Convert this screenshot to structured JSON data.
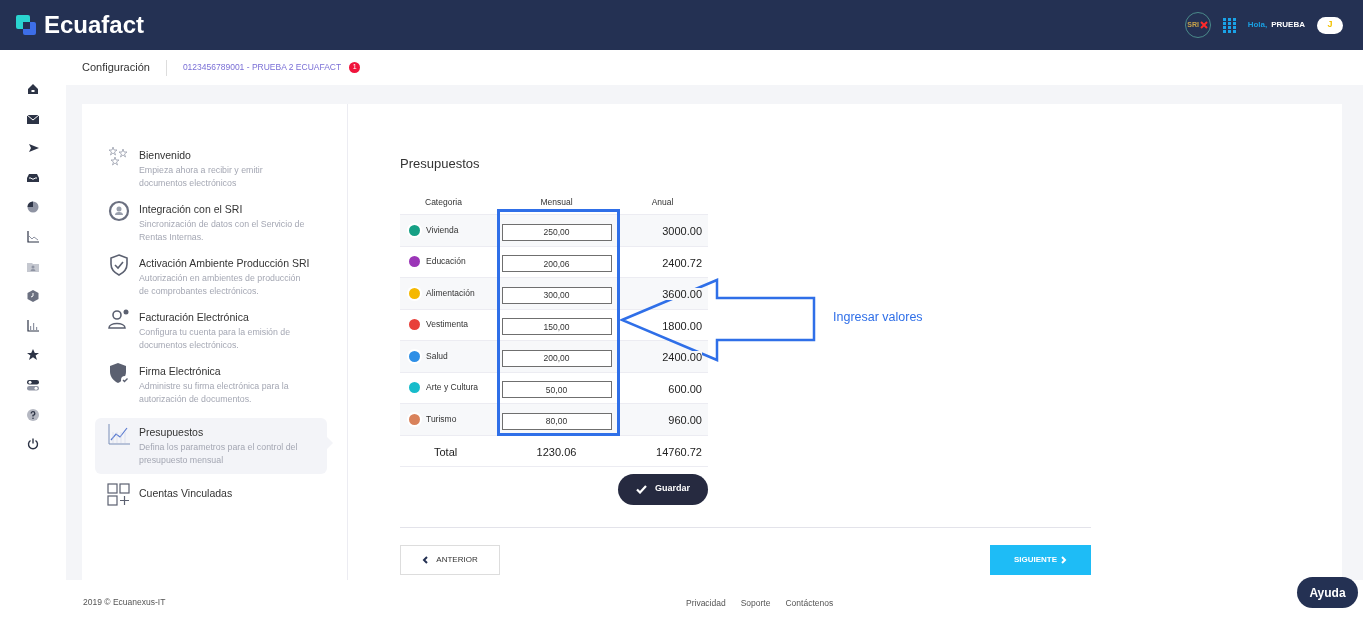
{
  "header": {
    "logo": "Ecuafact",
    "sri_badge": "SRI",
    "greeting": "Hola,",
    "user": "PRUEBA",
    "avatar": "J"
  },
  "breadcrumb": {
    "title": "Configuración",
    "company": "0123456789001 - PRUEBA 2 ECUAFACT",
    "notification_count": "1"
  },
  "steps": [
    {
      "title": "Bienvenido",
      "description": "Empieza ahora a recibir y emitir documentos electrónicos",
      "selected": false
    },
    {
      "title": "Integración con el SRI",
      "description": "Sincronización de datos con el Servicio de Rentas Internas.",
      "selected": false
    },
    {
      "title": "Activación Ambiente Producción SRI",
      "description": "Autorización en ambientes de producción de comprobantes electrónicos.",
      "selected": false
    },
    {
      "title": "Facturación Electrónica",
      "description": "Configura tu cuenta para la emisión de documentos electrónicos.",
      "selected": false
    },
    {
      "title": "Firma Electrónica",
      "description": "Administre su firma electrónica para la autorización de documentos.",
      "selected": false
    },
    {
      "title": "Presupuestos",
      "description": "Defina los parametros para el control del presupuesto mensual",
      "selected": true
    },
    {
      "title": "Cuentas Vinculadas",
      "selected": false
    }
  ],
  "budget": {
    "title": "Presupuestos",
    "columns": [
      "Categoria",
      "Mensual",
      "Anual"
    ],
    "rows": [
      {
        "category": "Vivienda",
        "color": "#16a085",
        "monthly": "250,00",
        "annual": "3000.00"
      },
      {
        "category": "Educación",
        "color": "#9b36b7",
        "monthly": "200,06",
        "annual": "2400.72"
      },
      {
        "category": "Alimentación",
        "color": "#f5b800",
        "monthly": "300,00",
        "annual": "3600.00"
      },
      {
        "category": "Vestimenta",
        "color": "#e8403a",
        "monthly": "150,00",
        "annual": "1800.00"
      },
      {
        "category": "Salud",
        "color": "#2f8fe6",
        "monthly": "200,00",
        "annual": "2400.00"
      },
      {
        "category": "Arte y Cultura",
        "color": "#17bccb",
        "monthly": "50,00",
        "annual": "600.00"
      },
      {
        "category": "Turismo",
        "color": "#d9825b",
        "monthly": "80,00",
        "annual": "960.00"
      }
    ],
    "total": {
      "label": "Total",
      "monthly": "1230.06",
      "annual": "14760.72"
    },
    "save_button": "Guardar"
  },
  "annotation": "Ingresar valores",
  "nav_buttons": {
    "previous": "ANTERIOR",
    "next": "SIGUIENTE"
  },
  "footer": {
    "copyright": "2019 © Ecuanexus-IT",
    "links": [
      "Privacidad",
      "Soporte",
      "Contáctenos"
    ],
    "help_button": "Ayuda"
  }
}
